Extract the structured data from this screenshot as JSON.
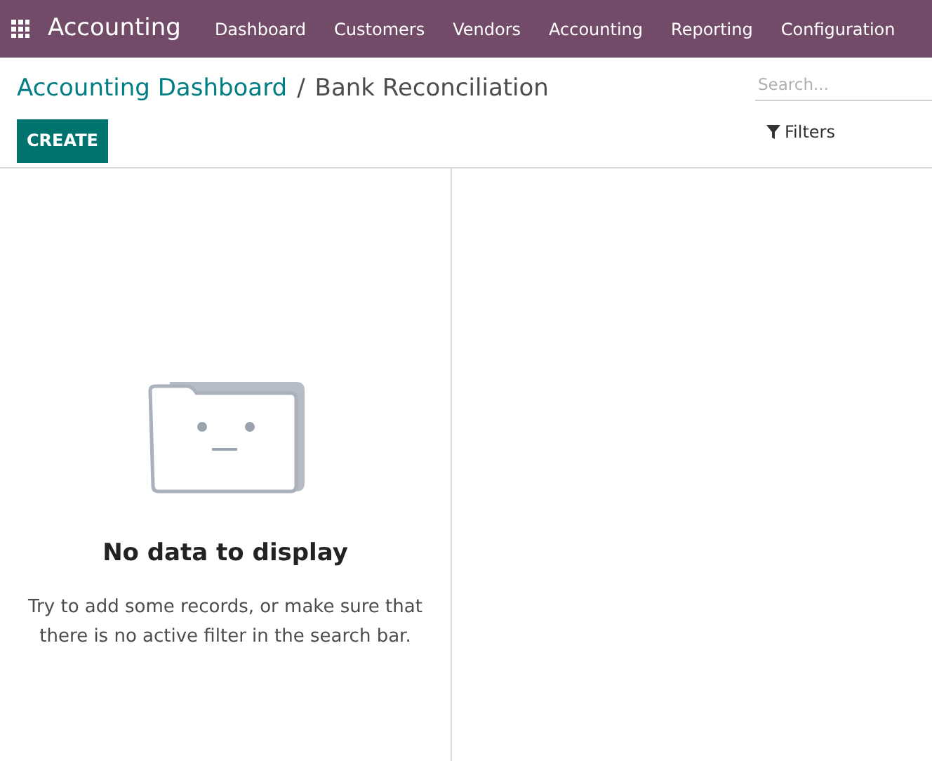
{
  "navbar": {
    "app_title": "Accounting",
    "menu": [
      {
        "label": "Dashboard"
      },
      {
        "label": "Customers"
      },
      {
        "label": "Vendors"
      },
      {
        "label": "Accounting"
      },
      {
        "label": "Reporting"
      },
      {
        "label": "Configuration"
      }
    ]
  },
  "breadcrumb": {
    "parent": "Accounting Dashboard",
    "separator": "/",
    "current": "Bank Reconciliation"
  },
  "create_button": "CREATE",
  "search": {
    "placeholder": "Search..."
  },
  "filters_button": "Filters",
  "empty_state": {
    "title": "No data to display",
    "message": "Try to add some records, or make sure that there is no active filter in the search bar."
  }
}
